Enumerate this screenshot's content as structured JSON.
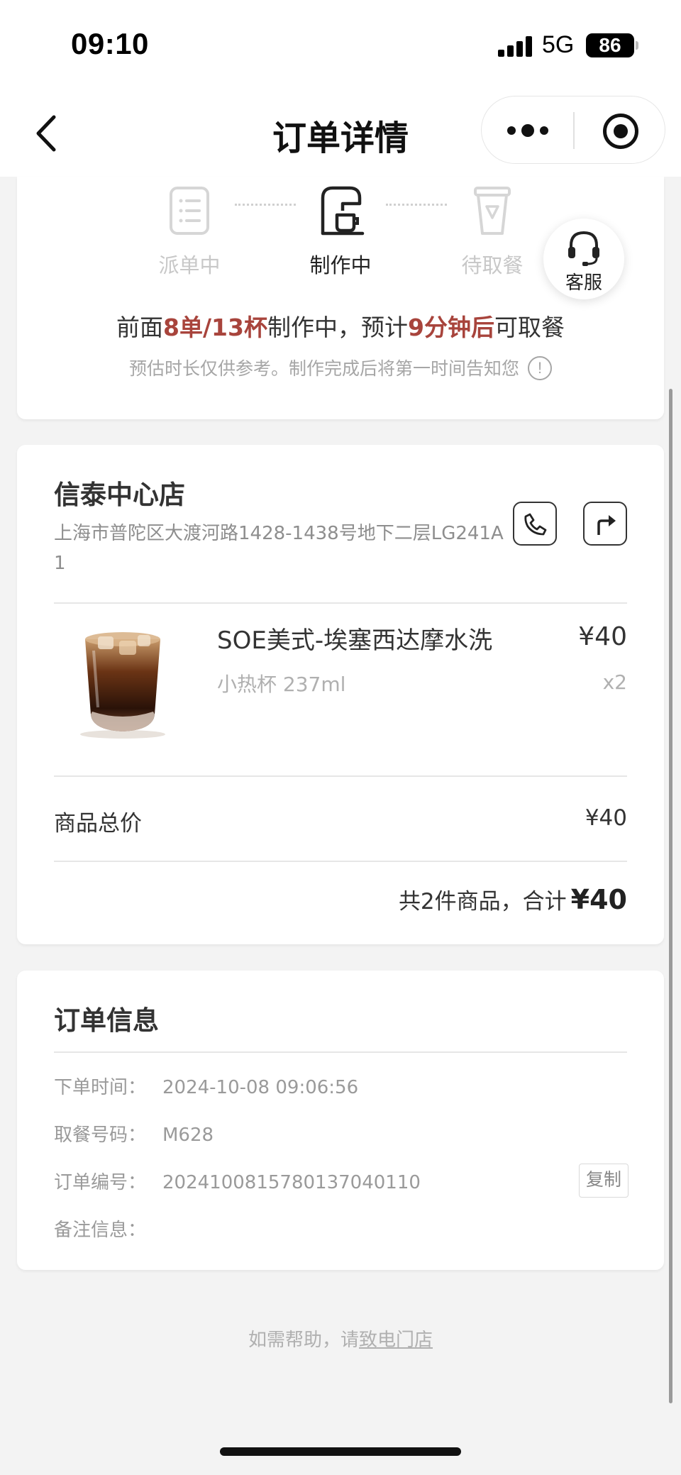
{
  "status_bar": {
    "time": "09:10",
    "network": "5G",
    "battery": "86"
  },
  "nav": {
    "title": "订单详情"
  },
  "progress": {
    "steps": [
      {
        "label": "派单中",
        "state": "done",
        "icon": "list-icon"
      },
      {
        "label": "制作中",
        "state": "active",
        "icon": "coffee-machine-icon"
      },
      {
        "label": "待取餐",
        "state": "pending",
        "icon": "cup-icon"
      }
    ],
    "service_label": "客服",
    "queue": {
      "prefix": "前面",
      "orders_cups": "8单/13杯",
      "mid": "制作中，预计",
      "minutes": "9分钟后",
      "suffix": "可取餐"
    },
    "tip": "预估时长仅供参考。制作完成后将第一时间告知您",
    "highlight_color": "#a8443c"
  },
  "store": {
    "name": "信泰中心店",
    "address": "上海市普陀区大渡河路1428-1438号地下二层LG241A1"
  },
  "product": {
    "name": "SOE美式-埃塞西达摩水洗",
    "price": "¥40",
    "spec": "小热杯 237ml",
    "qty": "x2"
  },
  "summary": {
    "subtotal_label": "商品总价",
    "subtotal_value": "¥40",
    "total_prefix": "共2件商品，合计",
    "total_amount": "¥40"
  },
  "order_info": {
    "title": "订单信息",
    "rows": [
      {
        "key": "下单时间：",
        "value": "2024-10-08 09:06:56"
      },
      {
        "key": "取餐号码：",
        "value": "M628"
      },
      {
        "key": "订单编号：",
        "value": "20241008157801370401​10"
      },
      {
        "key": "备注信息：",
        "value": ""
      }
    ],
    "copy_label": "复制"
  },
  "help": {
    "prefix": "如需帮助，请",
    "link": "致电门店"
  }
}
